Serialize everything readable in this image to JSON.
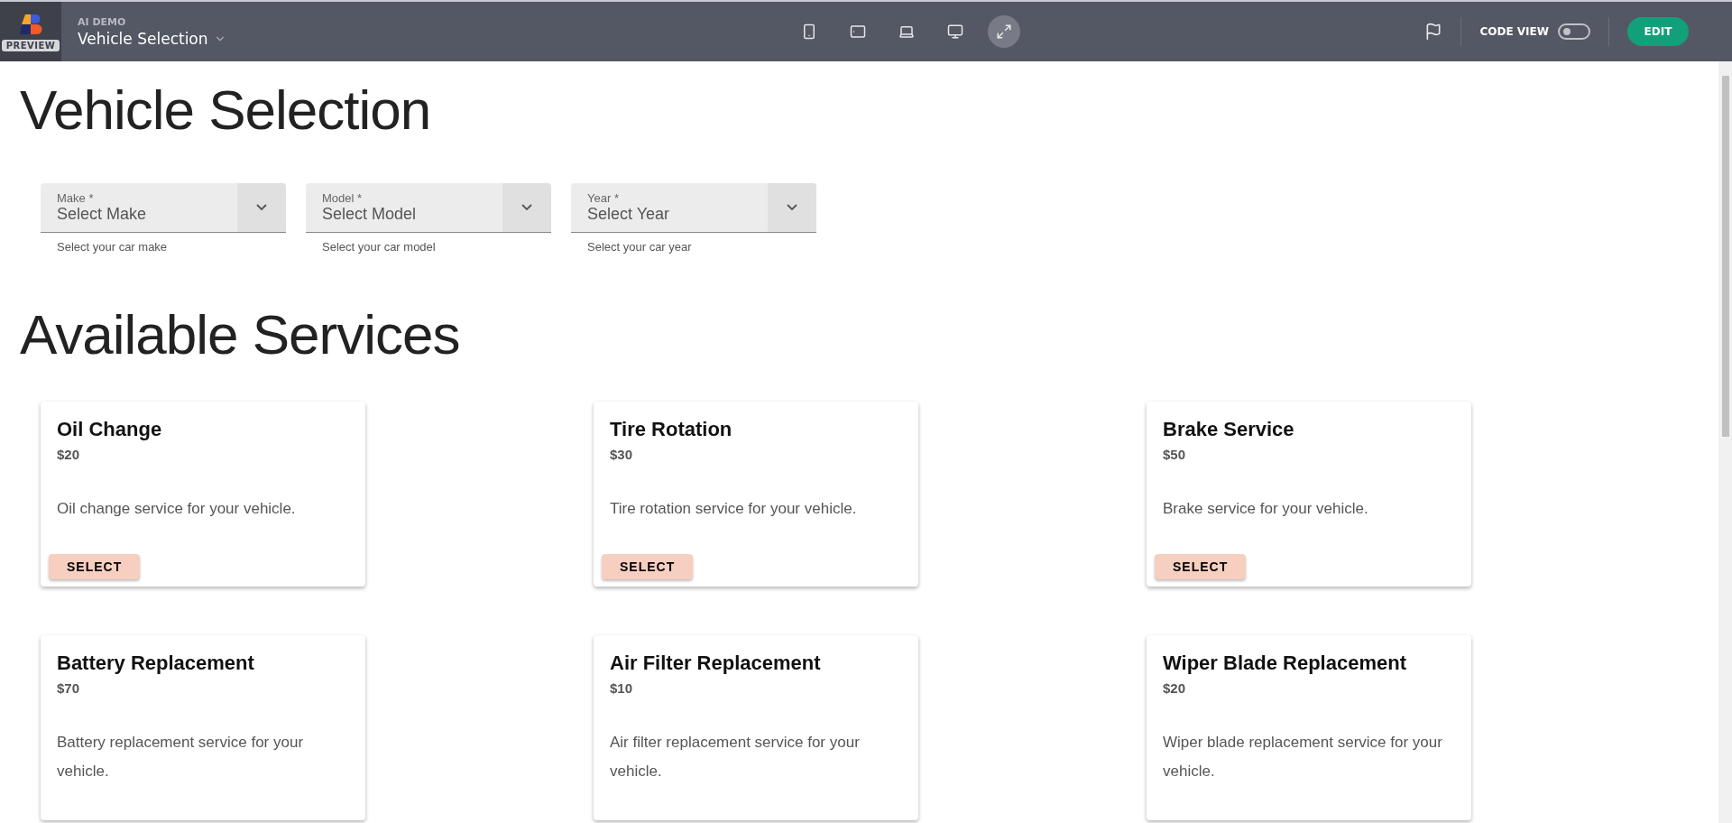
{
  "topbar": {
    "badge": "PREVIEW",
    "project": "AI DEMO",
    "page_title": "Vehicle Selection",
    "devices": [
      {
        "kind": "phone",
        "selected": false
      },
      {
        "kind": "tablet",
        "selected": false
      },
      {
        "kind": "laptop",
        "selected": false
      },
      {
        "kind": "desktop",
        "selected": false
      },
      {
        "kind": "fullscreen",
        "selected": true
      }
    ],
    "code_view": {
      "label": "CODE VIEW",
      "on": false
    },
    "edit_button": "EDIT"
  },
  "heading": "Vehicle Selection",
  "fields": [
    {
      "label": "Make *",
      "placeholder": "Select Make",
      "helper": "Select your car make"
    },
    {
      "label": "Model *",
      "placeholder": "Select Model",
      "helper": "Select your car model"
    },
    {
      "label": "Year *",
      "placeholder": "Select Year",
      "helper": "Select your car year"
    }
  ],
  "services_heading": "Available Services",
  "services": [
    {
      "name": "Oil Change",
      "price": "$20",
      "description": "Oil change service for your vehicle.",
      "button": "SELECT"
    },
    {
      "name": "Tire Rotation",
      "price": "$30",
      "description": "Tire rotation service for your vehicle.",
      "button": "SELECT"
    },
    {
      "name": "Brake Service",
      "price": "$50",
      "description": "Brake service for your vehicle.",
      "button": "SELECT"
    },
    {
      "name": "Battery Replacement",
      "price": "$70",
      "description": "Battery replacement service for your vehicle."
    },
    {
      "name": "Air Filter Replacement",
      "price": "$10",
      "description": "Air filter replacement service for your vehicle."
    },
    {
      "name": "Wiper Blade Replacement",
      "price": "$20",
      "description": "Wiper blade replacement service for your vehicle."
    }
  ]
}
